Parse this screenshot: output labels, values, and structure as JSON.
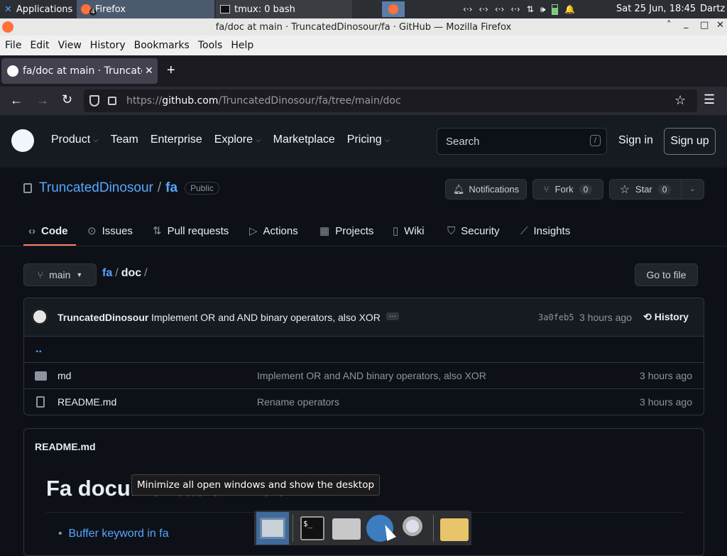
{
  "taskbar": {
    "applications": "Applications",
    "firefox_task": "Firefox",
    "firefox_badge": "4",
    "terminal_task": "tmux: 0 bash",
    "clock": "Sat 25 Jun, 18:45",
    "user": "Dartz"
  },
  "window": {
    "title": "fa/doc at main · TruncatedDinosour/fa · GitHub — Mozilla Firefox"
  },
  "menu": [
    "File",
    "Edit",
    "View",
    "History",
    "Bookmarks",
    "Tools",
    "Help"
  ],
  "browser": {
    "tab_title": "fa/doc at main · Truncate",
    "url_prefix": "https://",
    "url_host": "github.com",
    "url_path": "/TruncatedDinosour/fa/tree/main/doc"
  },
  "github": {
    "nav": [
      "Product",
      "Team",
      "Enterprise",
      "Explore",
      "Marketplace",
      "Pricing"
    ],
    "search_placeholder": "Search",
    "search_key": "/",
    "sign_in": "Sign in",
    "sign_up": "Sign up",
    "owner": "TruncatedDinosour",
    "sep": "/",
    "repo": "fa",
    "visibility": "Public",
    "notifications": "Notifications",
    "fork_label": "Fork",
    "fork_count": "0",
    "star_label": "Star",
    "star_count": "0",
    "tabs": [
      "Code",
      "Issues",
      "Pull requests",
      "Actions",
      "Projects",
      "Wiki",
      "Security",
      "Insights"
    ],
    "branch": "main",
    "path_root": "fa",
    "path_dir": "doc",
    "path_end": "/",
    "goto_file": "Go to file",
    "commit": {
      "author": "TruncatedDinosour",
      "message": "Implement OR and AND binary operators, also XOR",
      "hash": "3a0feb5",
      "time": "3 hours ago",
      "history": "History"
    },
    "parent": "..",
    "files": [
      {
        "name": "md",
        "type": "folder",
        "message": "Implement OR and AND binary operators, also XOR",
        "time": "3 hours ago"
      },
      {
        "name": "README.md",
        "type": "file",
        "message": "Rename operators",
        "time": "3 hours ago"
      }
    ],
    "readme_title": "README.md",
    "readme_heading": "Fa documentation index",
    "readme_item": "Buffer keyword in fa"
  },
  "tooltip": "Minimize all open windows and show the desktop"
}
